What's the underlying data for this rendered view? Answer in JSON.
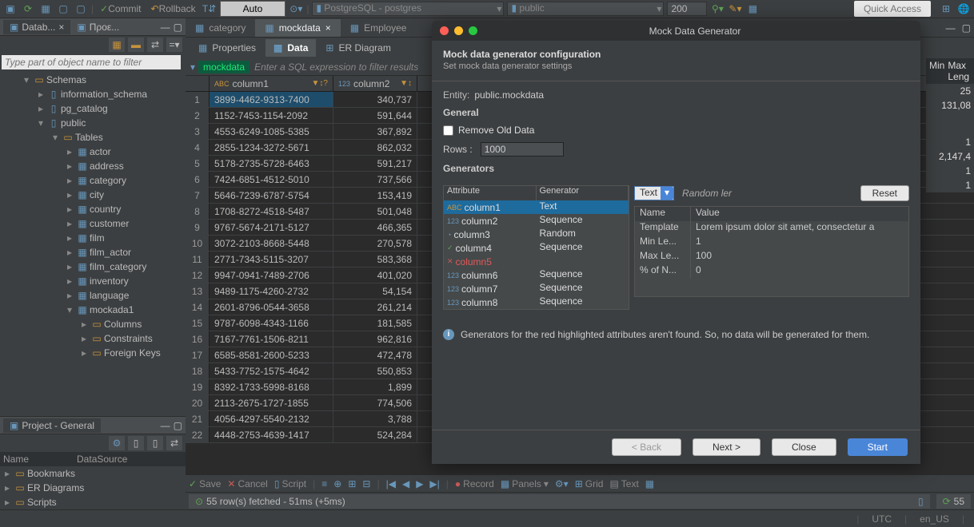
{
  "toolbar": {
    "commit": "Commit",
    "rollback": "Rollback",
    "auto": "Auto",
    "connection": "PostgreSQL - postgres",
    "schema": "public",
    "limit": "200",
    "quick_access": "Quick Access"
  },
  "left_panel": {
    "db_tab": "Datab...",
    "proj_tab": "Προε...",
    "search_placeholder": "Type part of object name to filter",
    "tree": {
      "schemas": "Schemas",
      "info_schema": "information_schema",
      "pg_catalog": "pg_catalog",
      "public": "public",
      "tables_lbl": "Tables",
      "tables": [
        "actor",
        "address",
        "category",
        "city",
        "country",
        "customer",
        "film",
        "film_actor",
        "film_category",
        "inventory",
        "language",
        "mockada1"
      ],
      "mock_children": [
        "Columns",
        "Constraints",
        "Foreign Keys"
      ]
    },
    "project": {
      "title": "Project - General",
      "headers": {
        "name": "Name",
        "ds": "DataSource"
      },
      "items": [
        "Bookmarks",
        "ER Diagrams",
        "Scripts"
      ]
    }
  },
  "editor": {
    "tabs": {
      "category": "category",
      "mockdata": "mockdata",
      "employee": "Employee"
    },
    "sub_tabs": {
      "props": "Properties",
      "data": "Data",
      "er": "ER Diagram"
    },
    "filter_chip": "mockdata",
    "filter_ph": "Enter a SQL expression to filter results"
  },
  "grid": {
    "cols": {
      "c1": "column1",
      "c2": "column2"
    },
    "rows": [
      {
        "n": 1,
        "c1": "3899-4462-9313-7400",
        "c2": "340,737"
      },
      {
        "n": 2,
        "c1": "1152-7453-1154-2092",
        "c2": "591,644"
      },
      {
        "n": 3,
        "c1": "4553-6249-1085-5385",
        "c2": "367,892"
      },
      {
        "n": 4,
        "c1": "2855-1234-3272-5671",
        "c2": "862,032"
      },
      {
        "n": 5,
        "c1": "5178-2735-5728-6463",
        "c2": "591,217"
      },
      {
        "n": 6,
        "c1": "7424-6851-4512-5010",
        "c2": "737,566"
      },
      {
        "n": 7,
        "c1": "5646-7239-6787-5754",
        "c2": "153,419"
      },
      {
        "n": 8,
        "c1": "1708-8272-4518-5487",
        "c2": "501,048"
      },
      {
        "n": 9,
        "c1": "9767-5674-2171-5127",
        "c2": "466,365"
      },
      {
        "n": 10,
        "c1": "3072-2103-8668-5448",
        "c2": "270,578"
      },
      {
        "n": 11,
        "c1": "2771-7343-5115-3207",
        "c2": "583,368"
      },
      {
        "n": 12,
        "c1": "9947-0941-7489-2706",
        "c2": "401,020"
      },
      {
        "n": 13,
        "c1": "9489-1175-4260-2732",
        "c2": "54,154"
      },
      {
        "n": 14,
        "c1": "2601-8796-0544-3658",
        "c2": "261,214"
      },
      {
        "n": 15,
        "c1": "9787-6098-4343-1166",
        "c2": "181,585"
      },
      {
        "n": 16,
        "c1": "7167-7761-1506-8211",
        "c2": "962,816"
      },
      {
        "n": 17,
        "c1": "6585-8581-2600-5233",
        "c2": "472,478"
      },
      {
        "n": 18,
        "c1": "5433-7752-1575-4642",
        "c2": "550,853"
      },
      {
        "n": 19,
        "c1": "8392-1733-5998-8168",
        "c2": "1,899"
      },
      {
        "n": 20,
        "c1": "2113-2675-1727-1855",
        "c2": "774,506"
      },
      {
        "n": 21,
        "c1": "4056-4297-5540-2132",
        "c2": "3,788"
      },
      {
        "n": 22,
        "c1": "4448-2753-4639-1417",
        "c2": "524,284"
      }
    ]
  },
  "right_info": {
    "head1": "Min",
    "head2": "Max Leng",
    "r1": "25",
    "r2": "131,08",
    "r3": "1",
    "r4": "2,147,4",
    "r5": "1",
    "r6": "1"
  },
  "bottom": {
    "save": "Save",
    "cancel": "Cancel",
    "script": "Script",
    "record": "Record",
    "panels": "Panels",
    "grid": "Grid",
    "text": "Text",
    "fetch": "55 row(s) fetched - 51ms (+5ms)",
    "count": "55",
    "utc": "UTC",
    "locale": "en_US"
  },
  "dialog": {
    "title": "Mock Data Generator",
    "h1": "Mock data generator configuration",
    "h2": "Set mock data generator settings",
    "entity_lbl": "Entity:",
    "entity_val": "public.mockdata",
    "general": "General",
    "remove": "Remove Old Data",
    "rows_lbl": "Rows :",
    "rows_val": "1000",
    "gens_lbl": "Generators",
    "attr_h": "Attribute",
    "gen_h": "Generator",
    "attrs": [
      {
        "name": "column1",
        "gen": "Text",
        "icon": "abc",
        "sel": true
      },
      {
        "name": "column2",
        "gen": "Sequence",
        "icon": "123"
      },
      {
        "name": "column3",
        "gen": "Random",
        "icon": "clock"
      },
      {
        "name": "column4",
        "gen": "Sequence",
        "icon": "check"
      },
      {
        "name": "column5",
        "gen": "",
        "icon": "x",
        "red": true
      },
      {
        "name": "column6",
        "gen": "Sequence",
        "icon": "123"
      },
      {
        "name": "column7",
        "gen": "Sequence",
        "icon": "123"
      },
      {
        "name": "column8",
        "gen": "Sequence",
        "icon": "123"
      }
    ],
    "type_val": "Text",
    "random_it": "Random ler",
    "reset": "Reset",
    "prop_h_name": "Name",
    "prop_h_val": "Value",
    "props": [
      {
        "n": "Template",
        "v": "Lorem ipsum dolor sit amet, consectetur a"
      },
      {
        "n": "Min Le...",
        "v": "1"
      },
      {
        "n": "Max Le...",
        "v": "100"
      },
      {
        "n": "% of N...",
        "v": "0"
      }
    ],
    "warn": "Generators for the red highlighted attributes aren't found. So, no data will be generated for them.",
    "back": "< Back",
    "next": "Next >",
    "close": "Close",
    "start": "Start"
  }
}
